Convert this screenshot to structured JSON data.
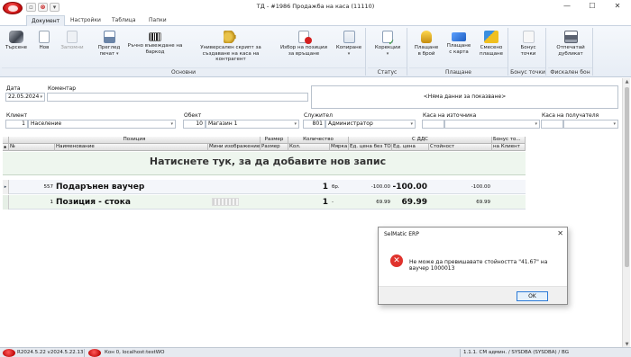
{
  "window": {
    "title": "ТД - #1986 Продажба на каса (11110)",
    "controls": {
      "minimize": "—",
      "maximize": "☐",
      "close": "✕"
    }
  },
  "ribbon_tabs": [
    "Документ",
    "Настройки",
    "Таблица",
    "Папки"
  ],
  "ribbon": {
    "group_main": {
      "label": "Основни",
      "buttons": {
        "search": "Търсене",
        "new": "Нов",
        "save": "Запомни",
        "preview_line1": "Преглед",
        "preview_line2": "печат",
        "barcode": "Ръчно въвеждане на баркод",
        "script_line1": "Универсален скрипт за",
        "script_line2": "създаване на каса на контрагент",
        "choose_line1": "Избор на позиции",
        "choose_line2": "за връщане",
        "copy": "Копиране"
      }
    },
    "group_status": {
      "label": "Статус",
      "corrections": "Корекции"
    },
    "group_payment": {
      "label": "Плащане",
      "cash_line1": "Плащане",
      "cash_line2": "в брой",
      "card_line1": "Плащане",
      "card_line2": "с карта",
      "mixed_line1": "Смесено",
      "mixed_line2": "плащане"
    },
    "group_bonus": {
      "label": "Бонус точки",
      "btn_line1": "Бонус",
      "btn_line2": "точки"
    },
    "group_fiscal": {
      "label": "Фискален бон",
      "btn_line1": "Отпечатай",
      "btn_line2": "дубликат"
    }
  },
  "form": {
    "date_label": "Дата",
    "date_value": "22.05.2024",
    "comment_label": "Коментар",
    "comment_value": "",
    "no_data": "<Няма данни за показване>",
    "client_label": "Клиент",
    "client_code": "1",
    "client_name": "Население",
    "object_label": "Обект",
    "object_code": "10",
    "object_name": "Магазин 1",
    "employee_label": "Служител",
    "employee_code": "801",
    "employee_name": "Администратор",
    "source_cash_label": "Каса на източника",
    "recipient_cash_label": "Каса на получателя"
  },
  "grid": {
    "groups": {
      "position": "Позиция",
      "size": "Размер",
      "quantity": "Количество",
      "with_vat": "С ДДС",
      "bonus": "Бонус то..."
    },
    "columns": {
      "no": "№",
      "name": "Наименование",
      "mini_image": "Мини изображение",
      "size": "Размер",
      "qty": "Кол.",
      "unit": "Мярка",
      "price_no_to": "Ед. цена без ТО",
      "price": "Ед. цена",
      "value": "Стойност",
      "per_client": "на Клиент"
    },
    "add_row_text": "Натиснете тук, за да добавите нов запис",
    "rows": [
      {
        "no": "557",
        "name": "Подарънен ваучер",
        "qty": "1",
        "unit": "бр.",
        "price_no_to": "-100.00",
        "price": "-100.00",
        "value": "-100.00"
      },
      {
        "no": "1",
        "name": "Позиция - стока",
        "qty": "1",
        "unit": "-",
        "price_no_to": "69.99",
        "price": "69.99",
        "value": "69.99"
      }
    ]
  },
  "dialog": {
    "title": "SelMatic ERP",
    "close": "✕",
    "message": "Не може да превишавате стойността \"41.67\" на ваучер 1000013",
    "ok": "OK"
  },
  "statusbar": {
    "version": "R2024.5.22 v2024.5.22.13",
    "connection": "Кон 0, localhost:testWO",
    "user": "1.1.1. СМ админ. / SYSDBA (SYSDBA) / BG"
  }
}
